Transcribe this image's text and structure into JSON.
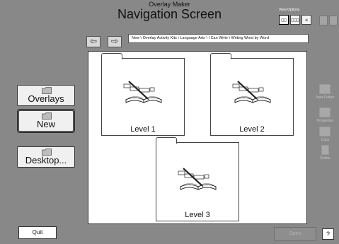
{
  "header": {
    "app_name": "Overlay Maker",
    "screen_title": "Navigation Screen"
  },
  "view_options": {
    "label": "View Options",
    "large_icons_glyph": "□□",
    "small_icons_glyph": "□□□",
    "list_glyph": "≡"
  },
  "navigation": {
    "back_icon": "left-arrow-icon",
    "forward_icon": "right-arrow-icon",
    "path": "New \\ Overlay Activity Kits \\ Language Arts \\ I Can Write \\ Writing Word by Word"
  },
  "folders": [
    {
      "label": "Level 1",
      "icon": "book-pen-icon"
    },
    {
      "label": "Level 2",
      "icon": "book-pen-icon"
    },
    {
      "label": "Level 3",
      "icon": "book-pen-icon"
    }
  ],
  "sidebar": {
    "overlays_label": "Overlays",
    "new_label": "New",
    "desktop_label": "Desktop..."
  },
  "right_tools": {
    "new_folder_label": "New Folder",
    "properties_label": "Properties",
    "copy_label": "Copy",
    "delete_label": "Delete"
  },
  "footer": {
    "quit_label": "Quit",
    "open_label": "Open",
    "help_label": "?"
  },
  "colors": {
    "background": "#888888",
    "panel": "#ffffff",
    "disabled_text": "#b0b0b0"
  }
}
